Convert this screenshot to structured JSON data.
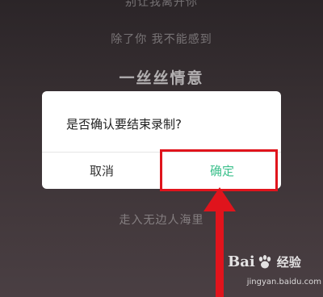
{
  "lyrics": {
    "line0": "别让我离开你",
    "line1": "除了你 我不能感到",
    "line2": "一丝丝情意",
    "line3": "走入无边人海里"
  },
  "dialog": {
    "message": "是否确认要结束录制?",
    "cancel_label": "取消",
    "confirm_label": "确定"
  },
  "annotation": {
    "highlight_color": "#e0141c",
    "arrow_color": "#e0141c",
    "confirm_color": "#3cc08c"
  },
  "watermark": {
    "brand": "Baidu经验",
    "url": "jingyan.baidu.com"
  }
}
